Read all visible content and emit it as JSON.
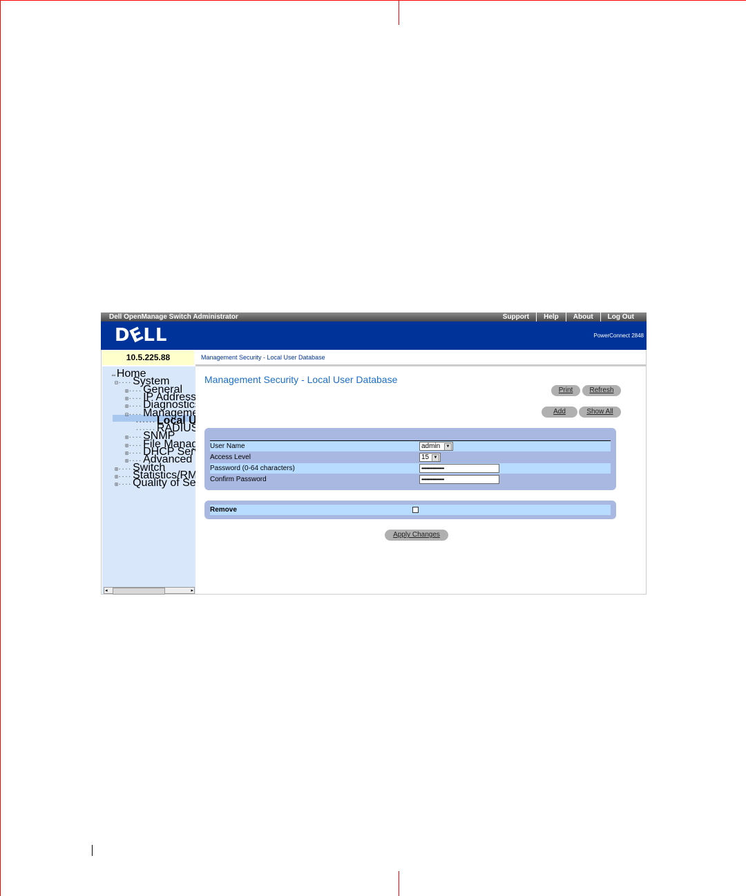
{
  "window": {
    "title": "Dell OpenManage Switch Administrator",
    "links": [
      "Support",
      "Help",
      "About",
      "Log Out"
    ],
    "logo": "DELL",
    "model": "PowerConnect 2848"
  },
  "ip": "10.5.225.88",
  "breadcrumb": "Management Security - Local User Database",
  "tree": [
    {
      "label": "Home",
      "level": 0,
      "box": ""
    },
    {
      "label": "System",
      "level": 1,
      "box": "⊟"
    },
    {
      "label": "General",
      "level": 2,
      "box": "⊞"
    },
    {
      "label": "IP Addressing",
      "level": 2,
      "box": "⊞"
    },
    {
      "label": "Diagnostics",
      "level": 2,
      "box": "⊞"
    },
    {
      "label": "Management Se",
      "level": 2,
      "box": "⊟"
    },
    {
      "label": "Local User I",
      "level": 3,
      "box": "",
      "selected": true
    },
    {
      "label": "RADIUS",
      "level": 3,
      "box": ""
    },
    {
      "label": "SNMP",
      "level": 2,
      "box": "⊞"
    },
    {
      "label": "File Managemer",
      "level": 2,
      "box": "⊞"
    },
    {
      "label": "DHCP Server",
      "level": 2,
      "box": "⊞"
    },
    {
      "label": "Advanced Settin",
      "level": 2,
      "box": "⊞"
    },
    {
      "label": "Switch",
      "level": 1,
      "box": "⊞"
    },
    {
      "label": "Statistics/RMON",
      "level": 1,
      "box": "⊞"
    },
    {
      "label": "Quality of Service",
      "level": 1,
      "box": "⊞"
    }
  ],
  "main": {
    "title": "Management Security - Local User Database",
    "buttons": {
      "print": "Print",
      "refresh": "Refresh",
      "add": "Add",
      "show_all": "Show All",
      "apply": "Apply Changes"
    },
    "fields": {
      "user_name": {
        "label": "User Name",
        "value": "admin"
      },
      "access_level": {
        "label": "Access Level",
        "value": "15"
      },
      "password": {
        "label": "Password (0-64 characters)",
        "value": "••••••••••••••••••"
      },
      "confirm": {
        "label": "Confirm Password",
        "value": "••••••••••••••••••"
      }
    },
    "remove": {
      "label": "Remove",
      "checked": false
    }
  },
  "colors": {
    "header": "#003399",
    "title": "#1a6fcc",
    "crop_marks": "#ff0000"
  }
}
